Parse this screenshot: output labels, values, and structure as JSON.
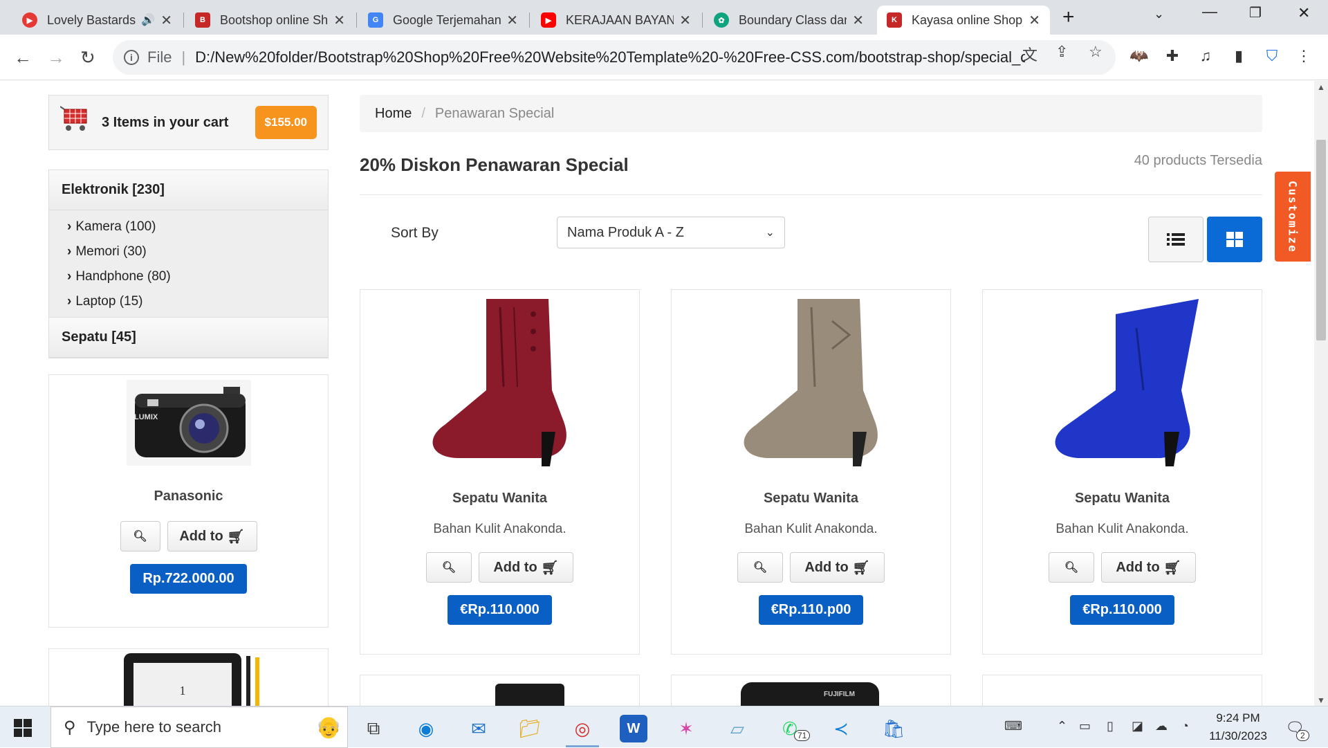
{
  "browser": {
    "tabs": [
      {
        "title": "Lovely Bastards",
        "color": "#e53935"
      },
      {
        "title": "Bootshop online Shopping",
        "color": "#c62828"
      },
      {
        "title": "Google Terjemahan",
        "color": "#4285f4"
      },
      {
        "title": "KERAJAAN BAYANGAN",
        "color": "#ff0000"
      },
      {
        "title": "Boundary Class dan",
        "color": "#10a37f"
      },
      {
        "title": "Kayasa online Shopping",
        "color": "#c62828"
      }
    ],
    "new_tab": "+",
    "address": {
      "scheme": "File",
      "url": "D:/New%20folder/Bootstrap%20Shop%20Free%20Website%20Template%20-%20Free-CSS.com/bootstrap-shop/special_offer.h..."
    }
  },
  "sidebar": {
    "cart": {
      "text": "3 Items in your cart",
      "price": "$155.00"
    },
    "categories": [
      {
        "label": "Elektronik [230]",
        "children": [
          "Kamera (100)",
          "Memori (30)",
          "Handphone (80)",
          "Laptop (15)"
        ]
      },
      {
        "label": "Sepatu [45]",
        "children": []
      }
    ],
    "featured": {
      "name": "Panasonic",
      "add_label": "Add to",
      "price": "Rp.722.000.00",
      "camera_brand": "LUMIX"
    },
    "featured2": {
      "page_number": "1"
    }
  },
  "main": {
    "breadcrumb": {
      "home": "Home",
      "separator": "/",
      "current": "Penawaran Special"
    },
    "title": "20% Diskon Penawaran Special",
    "count": "40 products Tersedia",
    "sort": {
      "label": "Sort By",
      "value": "Nama Produk A - Z"
    },
    "customize": "Customize",
    "products": [
      {
        "name": "Sepatu Wanita",
        "desc": "Bahan Kulit Anakonda.",
        "add_label": "Add to",
        "price": "€Rp.110.000",
        "color": "#8b1a2b"
      },
      {
        "name": "Sepatu Wanita",
        "desc": "Bahan Kulit Anakonda.",
        "add_label": "Add to",
        "price": "€Rp.110.p00",
        "color": "#9a8c7a"
      },
      {
        "name": "Sepatu Wanita",
        "desc": "Bahan Kulit Anakonda.",
        "add_label": "Add to",
        "price": "€Rp.110.000",
        "color": "#1f36c9"
      }
    ],
    "next_row_brand": "FUJIFILM"
  },
  "taskbar": {
    "search_placeholder": "Type here to search",
    "whatsapp_badge": "71",
    "time": "9:24 PM",
    "date": "11/30/2023",
    "notification_count": "2"
  }
}
